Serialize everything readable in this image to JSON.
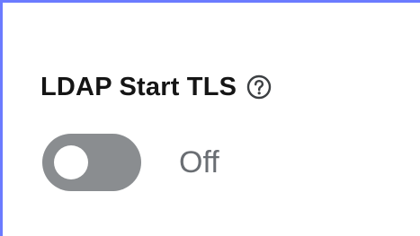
{
  "field": {
    "label": "LDAP Start TLS",
    "help_icon": "question-circle-icon"
  },
  "toggle": {
    "checked": false,
    "state_label": "Off"
  },
  "colors": {
    "focus_border": "#6b7bff",
    "switch_off": "#8a8d90",
    "label_text": "#151515",
    "state_text": "#6a6e73"
  }
}
